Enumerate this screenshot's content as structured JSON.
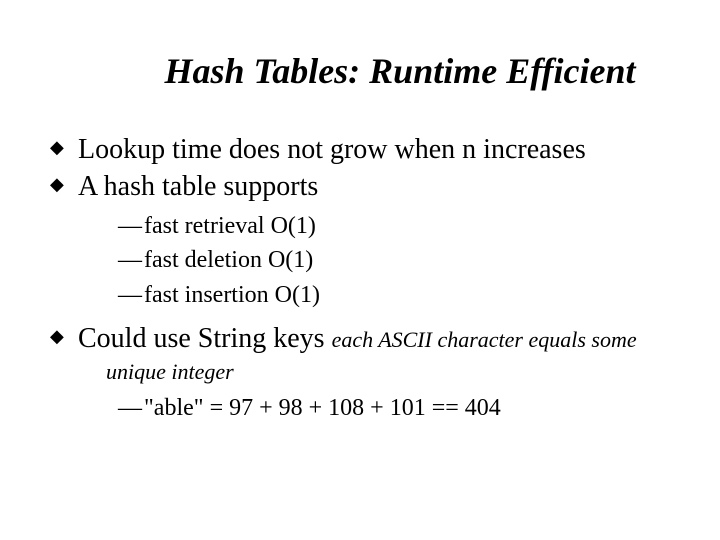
{
  "title": "Hash Tables: Runtime Efficient",
  "bullets": {
    "b1": "Lookup time does not grow when n increases",
    "b2": "A hash table supports",
    "b2_sub": {
      "s1": "fast retrieval   O(1)",
      "s2": "fast deletion   O(1)",
      "s3": "fast insertion  O(1)"
    },
    "b3_main": "Could use String keys ",
    "b3_tail": "each ASCII character equals some",
    "b3_tail2": "unique integer",
    "b3_sub": {
      "s1": "\"able\" = 97 + 98 + 108 + 101 == 404"
    }
  }
}
